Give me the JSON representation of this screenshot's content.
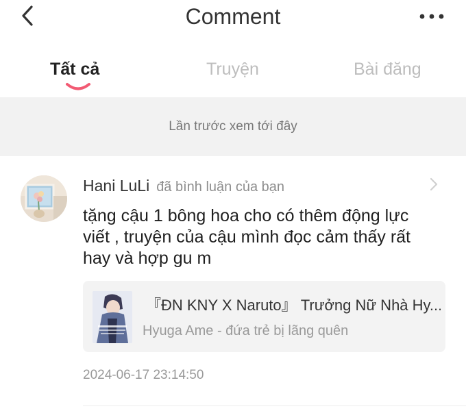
{
  "header": {
    "title": "Comment",
    "back_icon": "chevron-left-icon",
    "more_icon": "more-horizontal-icon"
  },
  "tabs": [
    {
      "label": "Tất cả",
      "active": true
    },
    {
      "label": "Truyện",
      "active": false
    },
    {
      "label": "Bài đăng",
      "active": false
    }
  ],
  "accent_color": "#f25a73",
  "last_viewed": "Lần trước xem tới đây",
  "notification": {
    "username": "Hani LuLi",
    "action": "đã bình luận của bạn",
    "comment": "tặng cậu 1 bông hoa cho có thêm động lực viết , truyện của cậu mình đọc cảm thấy rất hay và hợp gu m",
    "story": {
      "title": "『ĐN KNY X Naruto』 Trưởng Nữ Nhà Hy...",
      "author": "Hyuga Ame - đứa trẻ bị lãng quên"
    },
    "timestamp": "2024-06-17 23:14:50"
  }
}
